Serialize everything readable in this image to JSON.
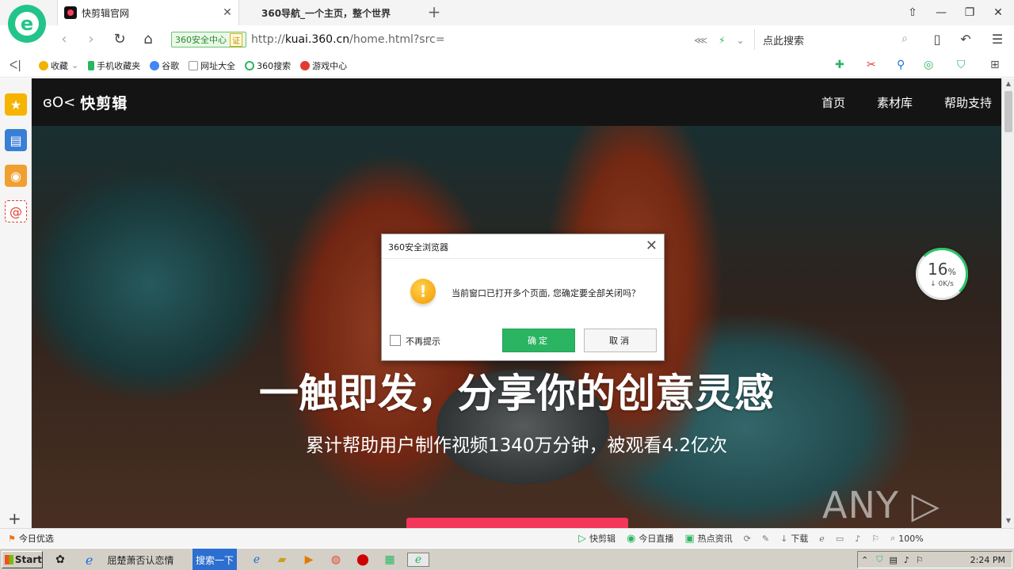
{
  "browser": {
    "logo_letter": "e",
    "tabs": [
      {
        "title": "快剪辑官网",
        "active": true,
        "close": "✕"
      },
      {
        "title": "360导航_一个主页，整个世界",
        "active": false
      }
    ],
    "newtab": "+",
    "window_controls": [
      "⇧",
      "—",
      "❐",
      "✕"
    ]
  },
  "addressbar": {
    "back": "‹",
    "forward": "›",
    "reload": "↻",
    "home": "⌂",
    "security_badge": "360安全中心",
    "cert": "证",
    "url_prefix": "http://",
    "url_host": "kuai.360.cn",
    "url_path": "/home.html?src=",
    "search_placeholder": "点此搜索",
    "search_icon": "⌕"
  },
  "bookmarks": [
    {
      "label": "收藏",
      "icon": "star-icon",
      "color": "#f2b200"
    },
    {
      "label": "手机收藏夹",
      "icon": "phone-icon",
      "color": "#2bb562"
    },
    {
      "label": "谷歌",
      "icon": "google-icon",
      "color": "#4285f4"
    },
    {
      "label": "网址大全",
      "icon": "page-icon",
      "color": "#999999"
    },
    {
      "label": "360搜索",
      "icon": "search360-icon",
      "color": "#2bb562"
    },
    {
      "label": "游戏中心",
      "icon": "game-icon",
      "color": "#e23a2e"
    }
  ],
  "site": {
    "logo_mark": "ɞO<",
    "logo_text": "快剪辑",
    "nav": [
      "首页",
      "素材库",
      "帮助支持"
    ],
    "hero_title": "一触即发，分享你的创意灵感",
    "hero_subtitle": "累计帮助用户制作视频1340万分钟，被观看4.2亿次",
    "watermark": "ANY ▷ RUN"
  },
  "speed_widget": {
    "percent": "16",
    "percent_sign": "%",
    "rate": "↓ 0K/s"
  },
  "dialog": {
    "title": "360安全浏览器",
    "close": "✕",
    "warning_glyph": "!",
    "message": "当前窗口已打开多个页面, 您确定要全部关闭吗？",
    "checkbox_label": "不再提示",
    "ok": "确定",
    "cancel": "取消"
  },
  "statusbar": {
    "left": "今日优选",
    "items": [
      "快剪辑",
      "今日直播",
      "热点资讯",
      "下载"
    ],
    "zoom": "100%"
  },
  "taskbar": {
    "start": "Start",
    "task_label": "屈楚萧否认恋情",
    "search_btn": "搜索一下",
    "clock": "2:24 PM"
  },
  "colors": {
    "accent_green": "#2bb562",
    "cta_red": "#f4365b",
    "header_dark": "#141414"
  }
}
